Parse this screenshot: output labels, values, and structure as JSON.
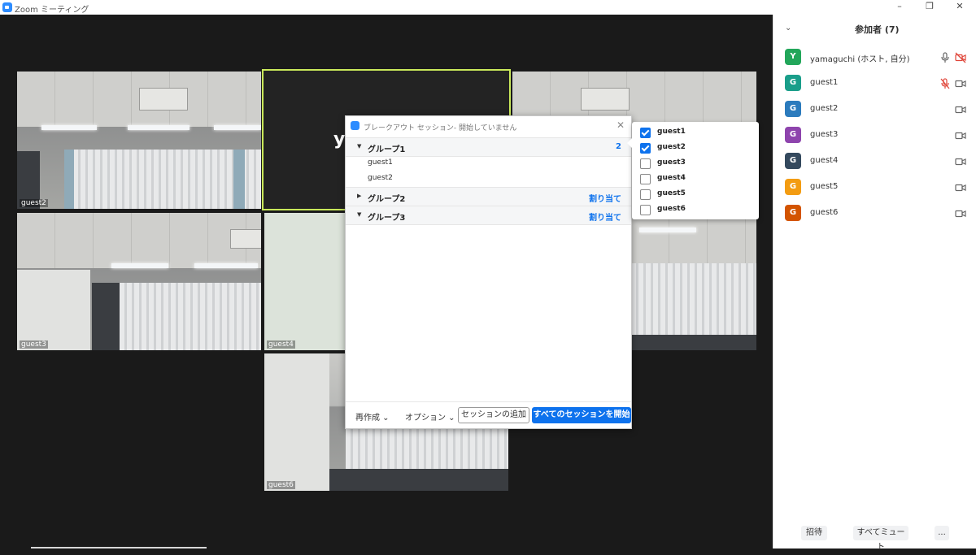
{
  "window": {
    "title": "Zoom ミーティング",
    "minimize": "–",
    "restore": "❐",
    "close": "✕"
  },
  "tiles": [
    {
      "label": "guest2"
    },
    {
      "label": "",
      "initial": "y"
    },
    {
      "label": ""
    },
    {
      "label": "guest3"
    },
    {
      "label": "guest4"
    },
    {
      "label": ""
    },
    {
      "label": "guest6"
    }
  ],
  "participants_panel": {
    "title": "参加者 (7)",
    "participants": [
      {
        "initial": "Y",
        "name": "yamaguchi (ホスト, 自分)",
        "color": "#22a65a",
        "mic": "mic-icon",
        "cam": "video-off-icon"
      },
      {
        "initial": "G",
        "name": "guest1",
        "color": "#1a9e8a",
        "mic": "mic-muted-icon",
        "cam": "video-icon"
      },
      {
        "initial": "G",
        "name": "guest2",
        "color": "#2b7bbd",
        "mic": "",
        "cam": "video-icon"
      },
      {
        "initial": "G",
        "name": "guest3",
        "color": "#8e44ad",
        "mic": "",
        "cam": "video-icon"
      },
      {
        "initial": "G",
        "name": "guest4",
        "color": "#34495e",
        "mic": "",
        "cam": "video-icon"
      },
      {
        "initial": "G",
        "name": "guest5",
        "color": "#f39c12",
        "mic": "",
        "cam": "video-icon"
      },
      {
        "initial": "G",
        "name": "guest6",
        "color": "#d35400",
        "mic": "",
        "cam": "video-icon"
      }
    ],
    "invite": "招待",
    "mute_all": "すべてミュート",
    "more": "..."
  },
  "breakout": {
    "title": "ブレークアウト セッション- 開始していません",
    "groups": [
      {
        "name": "グループ1",
        "right": "2",
        "expanded": true,
        "members": [
          "guest1",
          "guest2"
        ]
      },
      {
        "name": "グループ2",
        "right": "割り当て",
        "expanded": false,
        "members": []
      },
      {
        "name": "グループ3",
        "right": "割り当て",
        "expanded": false,
        "members": []
      }
    ],
    "recreate": "再作成 ⌄",
    "options": "オプション ⌄",
    "add_session": "セッションの追加",
    "start_all": "すべてのセッションを開始"
  },
  "assign_popup": {
    "items": [
      {
        "name": "guest1",
        "checked": true
      },
      {
        "name": "guest2",
        "checked": true
      },
      {
        "name": "guest3",
        "checked": false
      },
      {
        "name": "guest4",
        "checked": false
      },
      {
        "name": "guest5",
        "checked": false
      },
      {
        "name": "guest6",
        "checked": false
      }
    ]
  },
  "colors": {
    "accent": "#0e72ed",
    "active_speaker": "#c9e85a",
    "muted": "#e0463a"
  }
}
